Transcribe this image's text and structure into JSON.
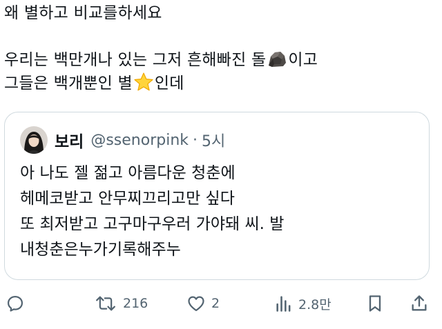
{
  "post": {
    "lines": [
      "왜 별하고 비교를하세요",
      "",
      "우리는 백만개나 있는 그저 흔해빠진 돌",
      "이고",
      "그들은 백개뿐인 별",
      "인데"
    ],
    "emojis": [
      "rock-emoji",
      "star-emoji"
    ]
  },
  "quote": {
    "name": "보리",
    "handle": "@ssenorpink",
    "separator": "·",
    "time": "5시",
    "lines": [
      "아 나도 젤 젊고 아름다운 청춘에",
      "헤메코받고 안무찌끄리고만 싶다",
      "또 최저받고 고구마구우러 가야돼 씨. 발",
      "내청춘은누가기록해주누"
    ]
  },
  "actions": {
    "reply_icon": "reply-icon",
    "repost_icon": "repost-icon",
    "repost_count": "216",
    "like_icon": "heart-icon",
    "like_count": "2",
    "views_icon": "views-icon",
    "views_count": "2.8만",
    "bookmark_icon": "bookmark-icon",
    "share_icon": "share-icon"
  },
  "colors": {
    "text": "#0f1419",
    "secondary": "#536471",
    "border": "#cfd9de"
  }
}
